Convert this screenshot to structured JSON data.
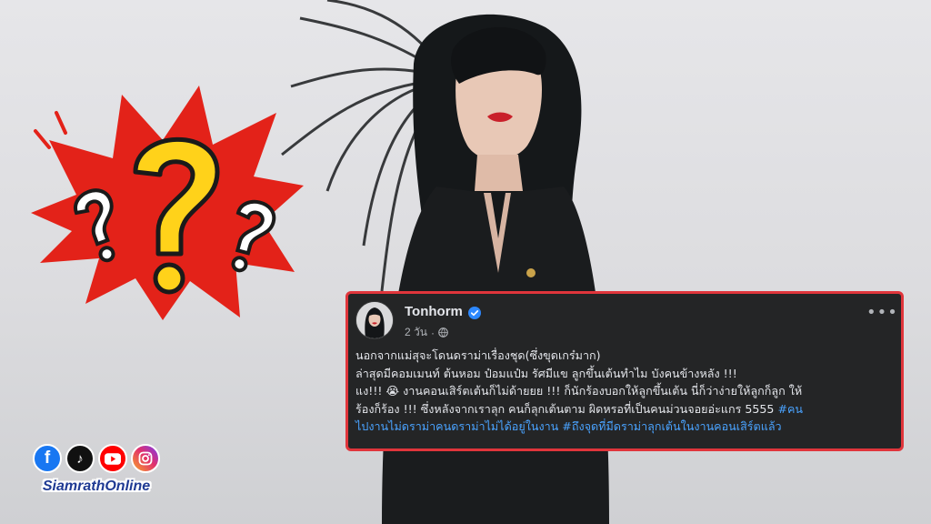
{
  "post": {
    "author": "Tonhorm",
    "time": "2 วัน",
    "more": "•••",
    "lines": {
      "l1": "นอกจากแม่สุจะโดนดราม่าเรื่องชุด(ซึ่งขุดเกร๋มาก)",
      "l2": "ล่าสุดมีคอมเมนท์ ต้นหอม ป๋อมแป๋ม รัศมีแข ลูกขึ้นเต้นทำไม บังคนข้างหลัง !!!",
      "l3": "แง!!! 😭 งานคอนเสิร์ตเต้นก็ไม่ด้ายยย !!! ก็นักร้องบอกให้ลูกขึ้นเต้น นี่ก็ว่าง่ายให้ลูกก็ลูก ให้",
      "l4_text": "ร้องก็ร้อง !!! ซึ่งหลังจากเราลุก คนก็ลุกเต้นตาม  ผิดหรอที่เป็นคนม่วนจอยอ่ะแกร 5555 ",
      "l4_tag": "#คน",
      "l5": "ไปงานไม่ดราม่าคนดราม่าไม่ได้อยู่ในงาน #ถึงจุดที่มีดราม่าลุกเต้นในงานคอนเสิร์ตแล้ว"
    }
  },
  "brand": {
    "name": "SiamrathOnline",
    "social": {
      "facebook": "f",
      "tiktok": "♪"
    }
  },
  "colors": {
    "card_bg": "#242526",
    "card_border": "#e0353b",
    "hashtag": "#4aa3ff",
    "burst_red": "#e32219",
    "question_yellow": "#ffd21a"
  },
  "icons": [
    "verified-icon",
    "globe-icon",
    "more-icon",
    "facebook-icon",
    "tiktok-icon",
    "youtube-icon",
    "instagram-icon"
  ]
}
